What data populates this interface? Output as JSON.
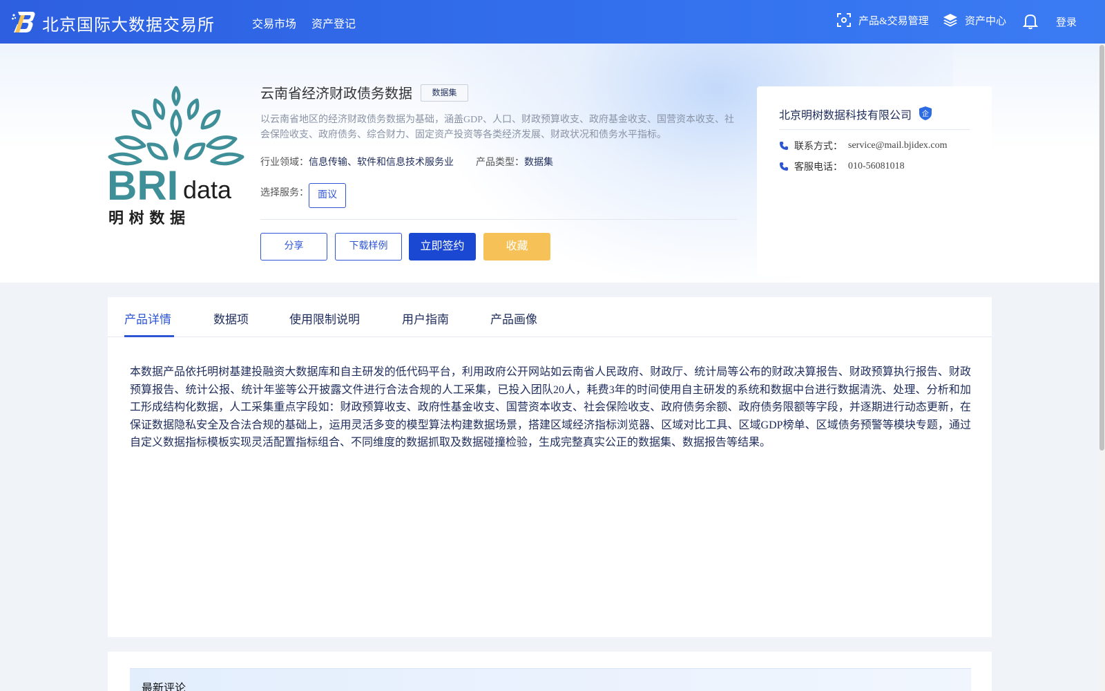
{
  "header": {
    "brand": "北京国际大数据交易所",
    "nav": [
      "交易市场",
      "资产登记"
    ],
    "product_mgmt": "产品&交易管理",
    "asset_center": "资产中心",
    "login": "登录"
  },
  "product": {
    "title": "云南省经济财政债务数据",
    "tag": "数据集",
    "description": "以云南省地区的经济财政债务数据为基础，涵盖GDP、人口、财政预算收支、政府基金收支、国营资本收支、社会保险收支、政府债务、综合财力、固定资产投资等各类经济发展、财政状况和债务水平指标。",
    "industry_label": "行业领域：",
    "industry_value": "信息传输、软件和信息技术服务业",
    "type_label": "产品类型：",
    "type_value": "数据集",
    "service_label": "选择服务：",
    "service_option": "面议",
    "logo_text_main": "BRI",
    "logo_text_sub": "data",
    "logo_text_cn": "明 树 数 据"
  },
  "actions": {
    "share": "分享",
    "download_sample": "下载样例",
    "sign_now": "立即签约",
    "favorite": "收藏"
  },
  "company": {
    "name": "北京明树数据科技有限公司",
    "badge": "企",
    "contact_label": "联系方式：",
    "contact_value": "service@mail.bjidex.com",
    "phone_label": "客服电话：",
    "phone_value": "010-56081018"
  },
  "tabs": [
    "产品详情",
    "数据项",
    "使用限制说明",
    "用户指南",
    "产品画像"
  ],
  "detail": {
    "text": "本数据产品依托明树基建投融资大数据库和自主研发的低代码平台，利用政府公开网站如云南省人民政府、财政厅、统计局等公布的财政决算报告、财政预算执行报告、财政预算报告、统计公报、统计年鉴等公开披露文件进行合法合规的人工采集，已投入团队20人，耗费3年的时间使用自主研发的系统和数据中台进行数据清洗、处理、分析和加工形成结构化数据，人工采集重点字段如：财政预算收支、政府性基金收支、国营资本收支、社会保险收支、政府债务余额、政府债务限额等字段，并逐期进行动态更新，在保证数据隐私安全及合法合规的基础上，运用灵活多变的模型算法构建数据场景，搭建区域经济指标浏览器、区域对比工具、区域GDP榜单、区域债务预警等模块专题，通过自定义数据指标模板实现灵活配置指标组合、不同维度的数据抓取及数据碰撞检验，生成完整真实公正的数据集、数据报告等结果。"
  },
  "comments": {
    "title": "最新评论"
  },
  "colors": {
    "header_blue": "#2d5fe0",
    "primary": "#1b48d2",
    "accent_gold": "#f6c257",
    "logo_teal": "#3f8f98"
  }
}
